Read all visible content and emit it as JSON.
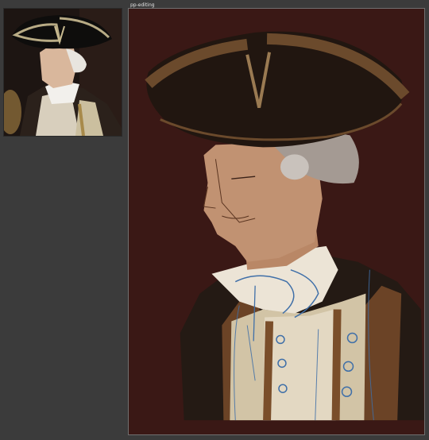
{
  "document": {
    "tab_title": "pp-editing"
  },
  "reference": {
    "description_icon": "reference-photo-icon"
  },
  "canvas": {
    "background_color": "#3a1815",
    "stroke_color": "#3f6fa8"
  }
}
